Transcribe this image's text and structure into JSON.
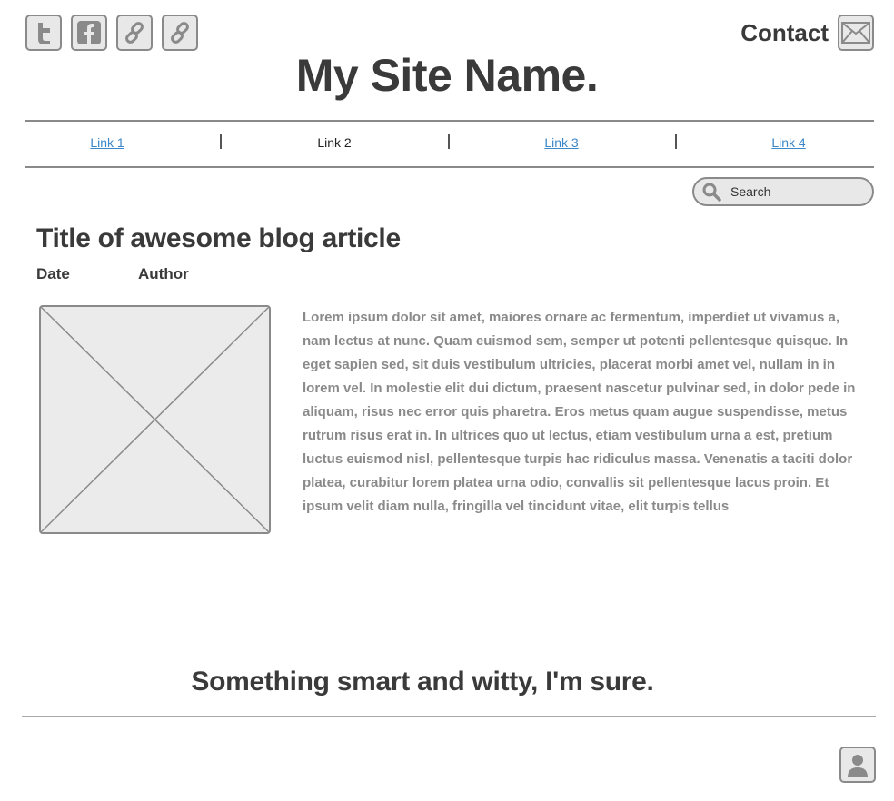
{
  "header": {
    "social_icons": [
      "twitter-icon",
      "facebook-icon",
      "link-icon",
      "link-icon"
    ],
    "contact_label": "Contact",
    "contact_icon": "envelope-icon",
    "site_title": "My Site Name."
  },
  "nav": {
    "links": [
      {
        "label": "Link 1",
        "active": false
      },
      {
        "label": "Link 2",
        "active": true
      },
      {
        "label": "Link 3",
        "active": false
      },
      {
        "label": "Link 4",
        "active": false
      }
    ],
    "separator": "|"
  },
  "search": {
    "placeholder": "Search",
    "icon": "search-icon"
  },
  "article": {
    "title": "Title of awesome blog article",
    "date_label": "Date",
    "author_label": "Author",
    "image": "image-placeholder",
    "body": "Lorem ipsum dolor sit amet, maiores ornare ac fermentum, imperdiet ut vivamus a, nam lectus at nunc. Quam euismod sem, semper ut potenti pellentesque quisque. In eget sapien sed, sit duis vestibulum ultricies, placerat morbi amet vel, nullam in in lorem vel. In molestie elit dui dictum, praesent nascetur pulvinar sed, in dolor pede in aliquam, risus nec error quis pharetra. Eros metus quam augue suspendisse, metus rutrum risus erat in.  In ultrices quo ut lectus, etiam vestibulum urna a est, pretium luctus euismod nisl, pellentesque turpis hac ridiculus massa. Venenatis a taciti dolor platea, curabitur lorem platea urna odio, convallis sit pellentesque lacus proin. Et ipsum velit diam nulla, fringilla vel tincidunt vitae, elit turpis tellus"
  },
  "footer": {
    "tagline": "Something smart and witty, I'm sure.",
    "avatar_icon": "user-icon"
  },
  "colors": {
    "link": "#3b87c8",
    "text": "#3a3a3a",
    "muted": "#8a8a8a",
    "border": "#8a8a8a",
    "fill": "#e8e8e8"
  }
}
